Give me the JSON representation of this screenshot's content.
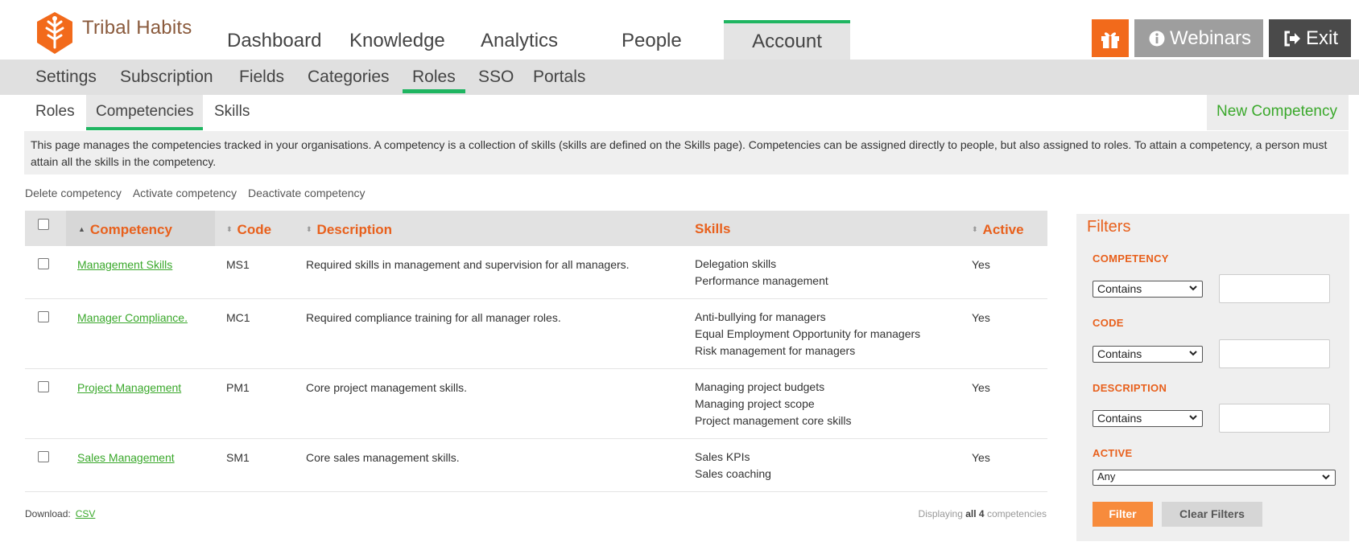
{
  "app": {
    "name": "Tribal Habits",
    "brand_color": "#f26a1b",
    "accent_green": "#1fb561"
  },
  "main_nav": [
    {
      "label": "Dashboard",
      "active": false
    },
    {
      "label": "Knowledge",
      "active": false
    },
    {
      "label": "Analytics",
      "active": false
    },
    {
      "label": "People",
      "active": false
    },
    {
      "label": "Account",
      "active": true
    }
  ],
  "top_actions": {
    "gift_icon": "gift-icon",
    "webinars_label": "Webinars",
    "exit_label": "Exit"
  },
  "sub_nav": [
    {
      "label": "Settings",
      "active": false
    },
    {
      "label": "Subscription",
      "active": false
    },
    {
      "label": "Fields",
      "active": false
    },
    {
      "label": "Categories",
      "active": false
    },
    {
      "label": "Roles",
      "active": true
    },
    {
      "label": "SSO",
      "active": false
    },
    {
      "label": "Portals",
      "active": false
    }
  ],
  "tabs": [
    {
      "label": "Roles",
      "active": false
    },
    {
      "label": "Competencies",
      "active": true
    },
    {
      "label": "Skills",
      "active": false
    }
  ],
  "new_button": "New Competency",
  "info_text": "This page manages the competencies tracked in your organisations. A competency is a collection of skills (skills are defined on the Skills page). Competencies can be assigned directly to people, but also assigned to roles. To attain a competency, a person must attain all the skills in the competency.",
  "bulk_actions": [
    "Delete competency",
    "Activate competency",
    "Deactivate competency"
  ],
  "table": {
    "headers": {
      "competency": "Competency",
      "code": "Code",
      "description": "Description",
      "skills": "Skills",
      "active": "Active"
    },
    "rows": [
      {
        "competency": "Management Skills",
        "code": "MS1",
        "description": "Required skills in management and supervision for all managers.",
        "skills": [
          "Delegation skills",
          "Performance management"
        ],
        "active": "Yes"
      },
      {
        "competency": "Manager Compliance.",
        "code": "MC1",
        "description": "Required compliance training for all manager roles.",
        "skills": [
          "Anti-bullying for managers",
          "Equal Employment Opportunity for managers",
          "Risk management for managers"
        ],
        "active": "Yes"
      },
      {
        "competency": "Project Management",
        "code": "PM1",
        "description": "Core project management skills.",
        "skills": [
          "Managing project budgets",
          "Managing project scope",
          "Project management core skills"
        ],
        "active": "Yes"
      },
      {
        "competency": "Sales Management",
        "code": "SM1",
        "description": "Core sales management skills.",
        "skills": [
          "Sales KPIs",
          "Sales coaching"
        ],
        "active": "Yes"
      }
    ]
  },
  "download": {
    "label": "Download:",
    "csv": "CSV"
  },
  "displaying": {
    "prefix": "Displaying",
    "all": "all",
    "count": "4",
    "suffix": "competencies"
  },
  "filters": {
    "title": "Filters",
    "competency_label": "COMPETENCY",
    "code_label": "CODE",
    "description_label": "DESCRIPTION",
    "active_label": "ACTIVE",
    "contains": "Contains",
    "any": "Any",
    "filter_button": "Filter",
    "clear_button": "Clear Filters"
  }
}
